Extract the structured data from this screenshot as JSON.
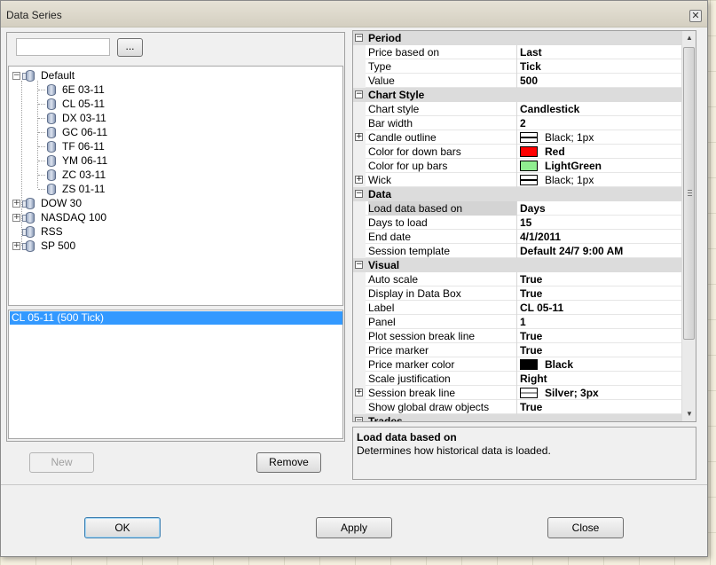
{
  "window": {
    "title": "Data Series",
    "close_glyph": "✕"
  },
  "search": {
    "value": "",
    "browse_label": "..."
  },
  "tree": {
    "nodes": [
      {
        "label": "Default",
        "expander": "−"
      },
      {
        "label": "6E 03-11"
      },
      {
        "label": "CL 05-11"
      },
      {
        "label": "DX 03-11"
      },
      {
        "label": "GC 06-11"
      },
      {
        "label": "TF 06-11"
      },
      {
        "label": "YM 06-11"
      },
      {
        "label": "ZC 03-11"
      },
      {
        "label": "ZS 01-11"
      },
      {
        "label": "DOW 30",
        "expander": "+"
      },
      {
        "label": "NASDAQ 100",
        "expander": "+"
      },
      {
        "label": "RSS"
      },
      {
        "label": "SP 500",
        "expander": "+"
      }
    ]
  },
  "series_list": {
    "items": [
      "CL 05-11 (500 Tick)"
    ]
  },
  "buttons": {
    "new": "New",
    "remove": "Remove",
    "ok": "OK",
    "apply": "Apply",
    "close": "Close"
  },
  "colors": {
    "selection": "#3399ff",
    "red": "#ff0000",
    "light_green": "#90ee90",
    "black": "#000000",
    "silver": "#c0c0c0"
  },
  "properties": {
    "period": {
      "title": "Period",
      "expander": "−",
      "rows": [
        {
          "name": "Price based on",
          "value": "Last"
        },
        {
          "name": "Type",
          "value": "Tick"
        },
        {
          "name": "Value",
          "value": "500"
        }
      ]
    },
    "chart_style": {
      "title": "Chart Style",
      "expander": "−",
      "rows": [
        {
          "name": "Chart style",
          "value": "Candlestick"
        },
        {
          "name": "Bar width",
          "value": "2"
        },
        {
          "name": "Candle outline",
          "value": "Black; 1px",
          "expander": "+"
        },
        {
          "name": "Color for down bars",
          "value": "Red"
        },
        {
          "name": "Color for up bars",
          "value": "LightGreen"
        },
        {
          "name": "Wick",
          "value": "Black; 1px",
          "expander": "+"
        }
      ]
    },
    "data": {
      "title": "Data",
      "expander": "−",
      "rows": [
        {
          "name": "Load data based on",
          "value": "Days"
        },
        {
          "name": "Days to load",
          "value": "15"
        },
        {
          "name": "End date",
          "value": "4/1/2011"
        },
        {
          "name": "Session template",
          "value": "Default 24/7 9:00 AM"
        }
      ]
    },
    "visual": {
      "title": "Visual",
      "expander": "−",
      "rows": [
        {
          "name": "Auto scale",
          "value": "True"
        },
        {
          "name": "Display in Data Box",
          "value": "True"
        },
        {
          "name": "Label",
          "value": "CL 05-11"
        },
        {
          "name": "Panel",
          "value": "1"
        },
        {
          "name": "Plot session break line",
          "value": "True"
        },
        {
          "name": "Price marker",
          "value": "True"
        },
        {
          "name": "Price marker color",
          "value": "Black"
        },
        {
          "name": "Scale justification",
          "value": "Right"
        },
        {
          "name": "Session break line",
          "value": "Silver; 3px",
          "expander": "+"
        },
        {
          "name": "Show global draw objects",
          "value": "True"
        }
      ]
    },
    "trades": {
      "title": "Trades",
      "expander": "−"
    }
  },
  "scroll": {
    "up": "▲",
    "down": "▼"
  },
  "description": {
    "title": "Load data based on",
    "text": "Determines how historical data is loaded."
  }
}
